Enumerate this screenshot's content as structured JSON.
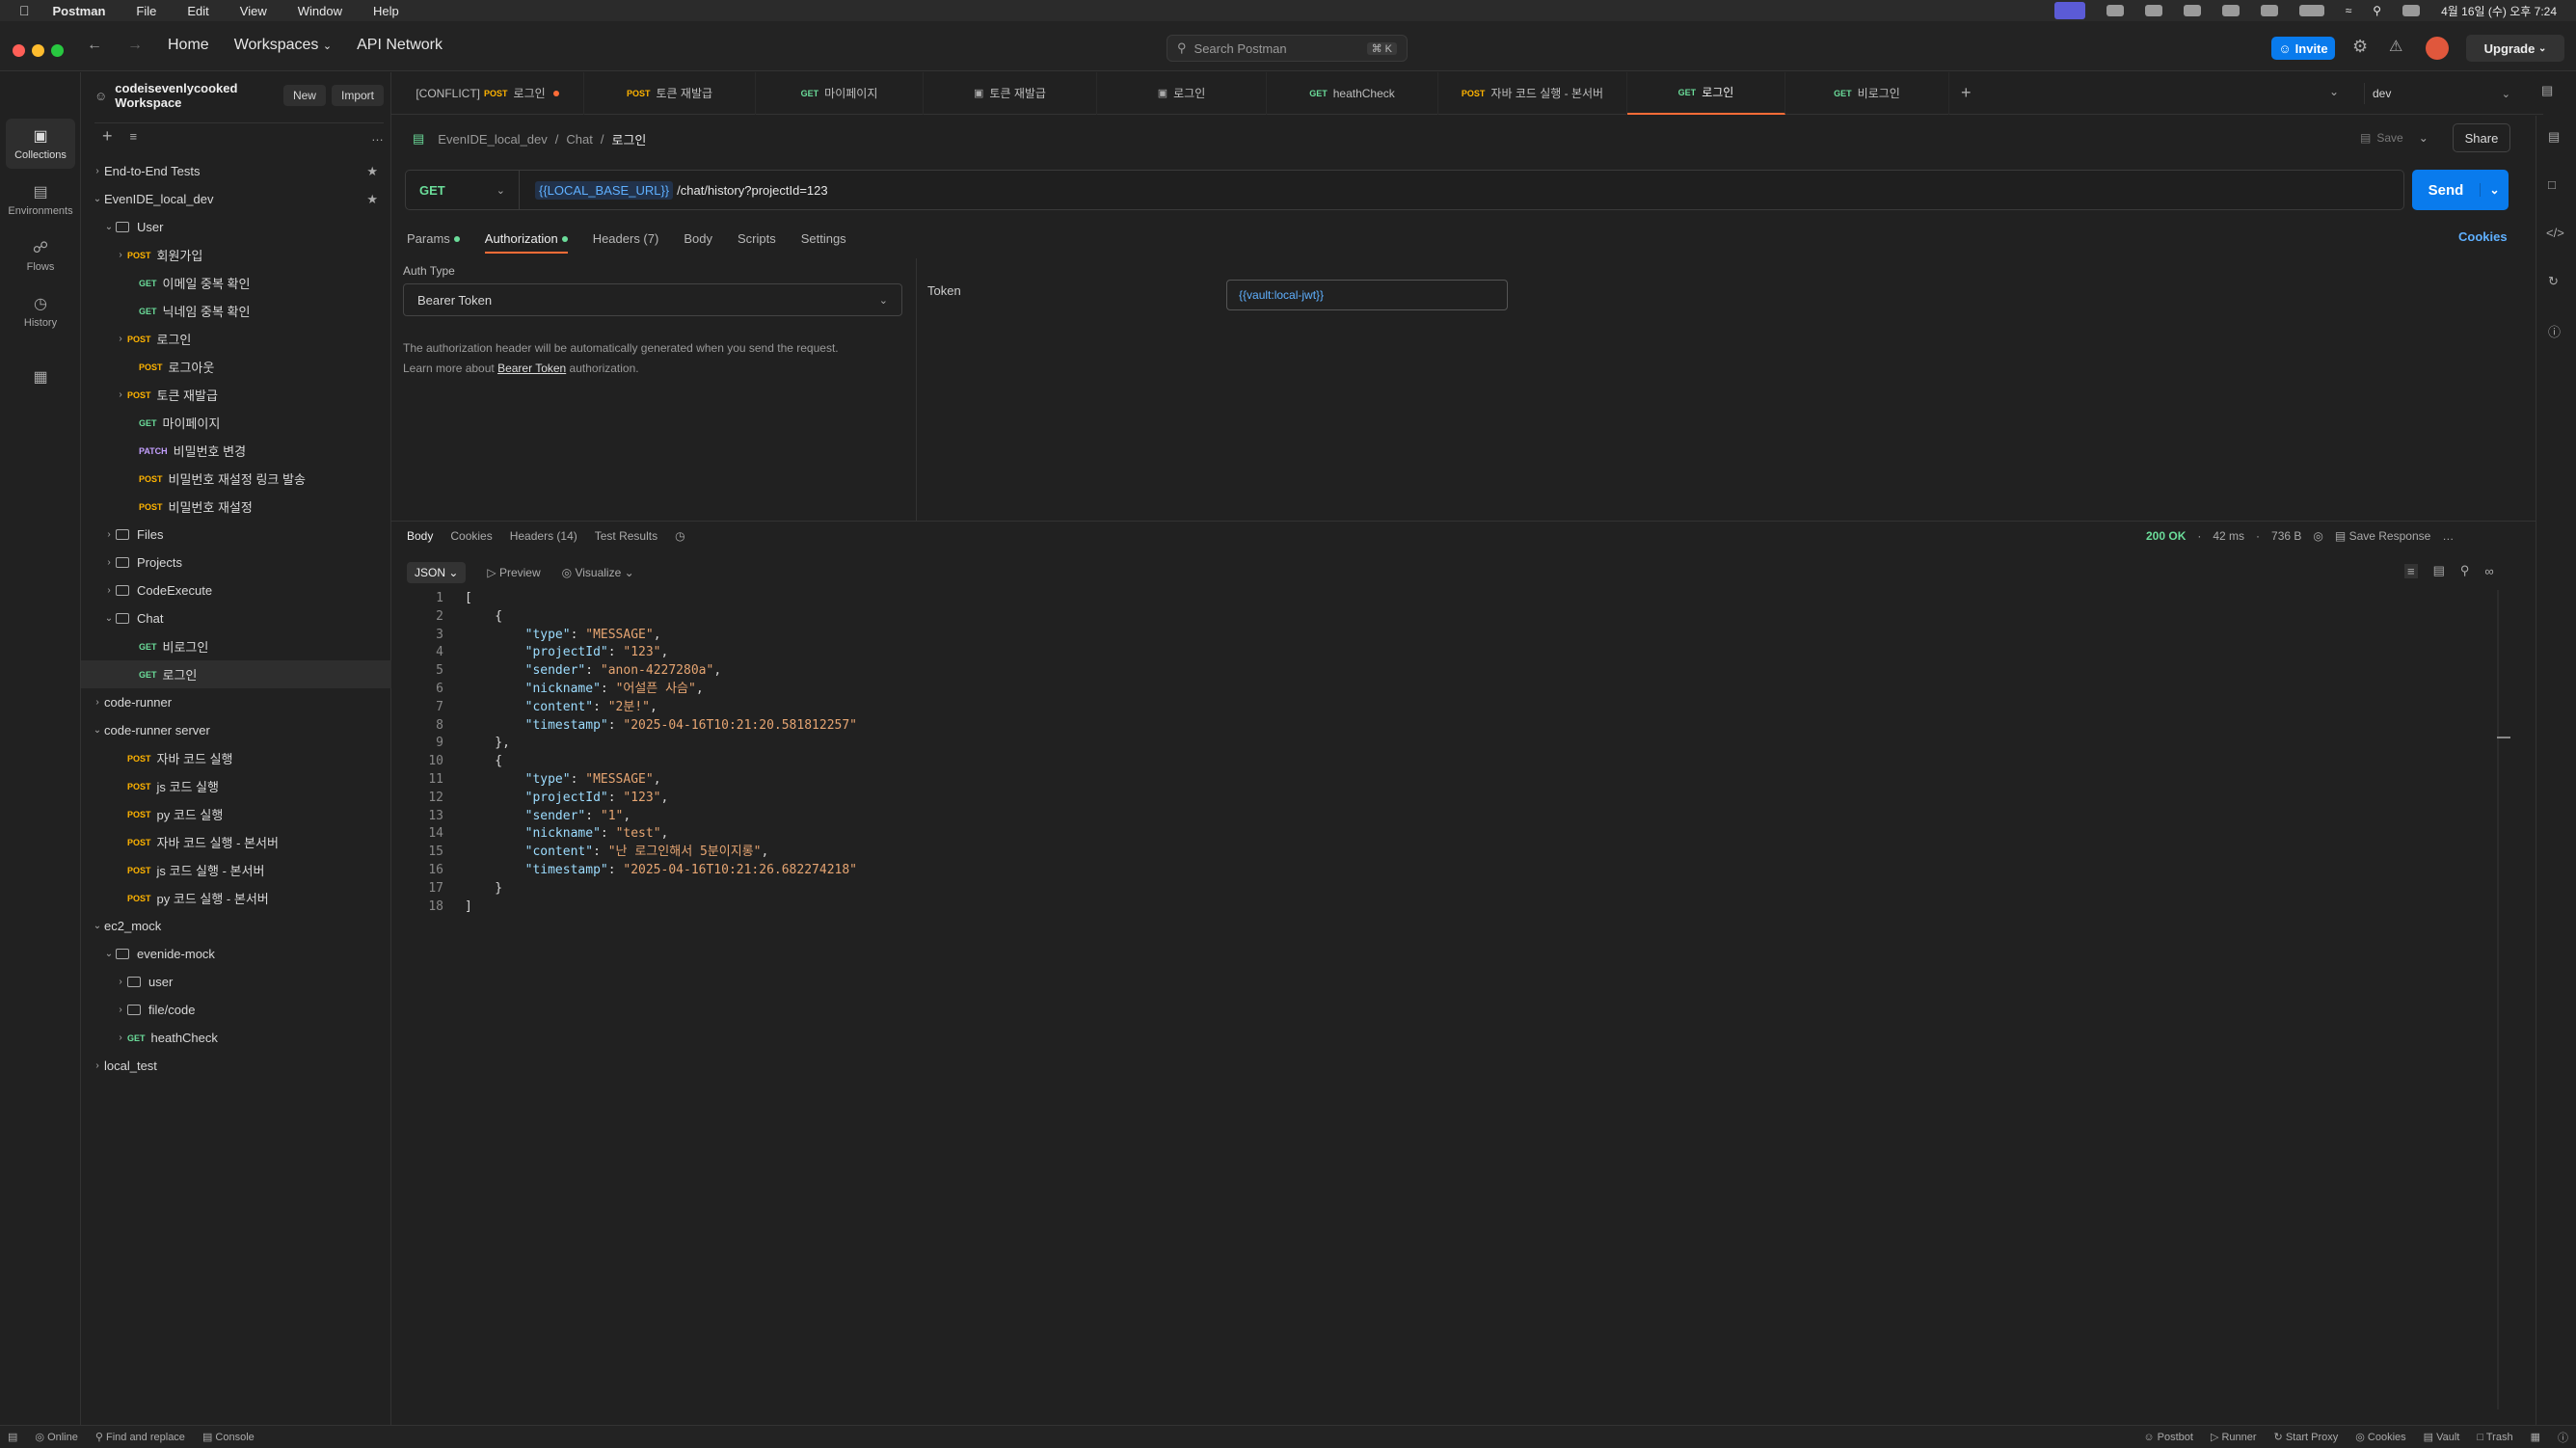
{
  "menubar": {
    "app": "Postman",
    "items": [
      "File",
      "Edit",
      "View",
      "Window",
      "Help"
    ],
    "datetime": "4월 16일 (수) 오후 7:24"
  },
  "nav": {
    "home": "Home",
    "workspaces": "Workspaces",
    "api_network": "API Network",
    "search_placeholder": "Search Postman",
    "search_kbd": "⌘ K",
    "invite": "Invite",
    "upgrade": "Upgrade"
  },
  "workspace": {
    "name": "codeisevenlycooked Workspace",
    "new": "New",
    "import": "Import"
  },
  "rail": [
    {
      "label": "Collections"
    },
    {
      "label": "Environments"
    },
    {
      "label": "Flows"
    },
    {
      "label": "History"
    }
  ],
  "tree": [
    {
      "depth": 0,
      "caret": "›",
      "label": "End-to-End Tests",
      "star": true
    },
    {
      "depth": 0,
      "caret": "⌄",
      "label": "EvenIDE_local_dev",
      "star": true
    },
    {
      "depth": 1,
      "caret": "⌄",
      "folder": true,
      "label": "User"
    },
    {
      "depth": 2,
      "caret": "›",
      "method": "POST",
      "label": "회원가입"
    },
    {
      "depth": 3,
      "method": "GET",
      "label": "이메일 중복 확인"
    },
    {
      "depth": 3,
      "method": "GET",
      "label": "닉네임 중복 확인"
    },
    {
      "depth": 2,
      "caret": "›",
      "method": "POST",
      "label": "로그인"
    },
    {
      "depth": 3,
      "method": "POST",
      "label": "로그아웃"
    },
    {
      "depth": 2,
      "caret": "›",
      "method": "POST",
      "label": "토큰 재발급"
    },
    {
      "depth": 3,
      "method": "GET",
      "label": "마이페이지"
    },
    {
      "depth": 3,
      "method": "PATCH",
      "label": "비밀번호 변경"
    },
    {
      "depth": 3,
      "method": "POST",
      "label": "비밀번호 재설정 링크 발송"
    },
    {
      "depth": 3,
      "method": "POST",
      "label": "비밀번호 재설정"
    },
    {
      "depth": 1,
      "caret": "›",
      "folder": true,
      "label": "Files"
    },
    {
      "depth": 1,
      "caret": "›",
      "folder": true,
      "label": "Projects"
    },
    {
      "depth": 1,
      "caret": "›",
      "folder": true,
      "label": "CodeExecute"
    },
    {
      "depth": 1,
      "caret": "⌄",
      "folder": true,
      "label": "Chat"
    },
    {
      "depth": 3,
      "method": "GET",
      "label": "비로그인"
    },
    {
      "depth": 3,
      "method": "GET",
      "label": "로그인",
      "selected": true
    },
    {
      "depth": 0,
      "caret": "›",
      "label": "code-runner"
    },
    {
      "depth": 0,
      "caret": "⌄",
      "label": "code-runner server"
    },
    {
      "depth": 2,
      "method": "POST",
      "label": "자바 코드 실행"
    },
    {
      "depth": 2,
      "method": "POST",
      "label": "js 코드 실행"
    },
    {
      "depth": 2,
      "method": "POST",
      "label": "py 코드 실행"
    },
    {
      "depth": 2,
      "method": "POST",
      "label": "자바 코드 실행 - 본서버"
    },
    {
      "depth": 2,
      "method": "POST",
      "label": "js 코드 실행 - 본서버"
    },
    {
      "depth": 2,
      "method": "POST",
      "label": "py 코드 실행 - 본서버"
    },
    {
      "depth": 0,
      "caret": "⌄",
      "label": "ec2_mock"
    },
    {
      "depth": 1,
      "caret": "⌄",
      "folder": true,
      "label": "evenide-mock"
    },
    {
      "depth": 2,
      "caret": "›",
      "folder": true,
      "label": "user"
    },
    {
      "depth": 2,
      "caret": "›",
      "folder": true,
      "label": "file/code"
    },
    {
      "depth": 2,
      "caret": "›",
      "method": "GET",
      "label": "heathCheck"
    },
    {
      "depth": 0,
      "caret": "›",
      "label": "local_test"
    }
  ],
  "tabs": [
    {
      "prefix": "[CONFLICT]",
      "method": "POST",
      "label": "로그인",
      "dot": true
    },
    {
      "method": "POST",
      "label": "토큰 재발급"
    },
    {
      "method": "GET",
      "label": "마이페이지"
    },
    {
      "icon": true,
      "label": "토큰 재발급"
    },
    {
      "icon": true,
      "label": "로그인"
    },
    {
      "method": "GET",
      "label": "heathCheck"
    },
    {
      "method": "POST",
      "label": "자바 코드 실행 - 본서버"
    },
    {
      "method": "GET",
      "label": "로그인",
      "active": true
    },
    {
      "method": "GET",
      "label": "비로그인"
    }
  ],
  "env": "dev",
  "breadcrumb": {
    "collection": "EvenIDE_local_dev",
    "folder": "Chat",
    "request": "로그인"
  },
  "actions": {
    "save": "Save",
    "share": "Share"
  },
  "request": {
    "method": "GET",
    "url_var": "{{LOCAL_BASE_URL}}",
    "url_path": "/chat/history?projectId=123",
    "send": "Send"
  },
  "req_tabs": {
    "params": "Params",
    "authorization": "Authorization",
    "headers": "Headers (7)",
    "body": "Body",
    "scripts": "Scripts",
    "settings": "Settings",
    "cookies": "Cookies"
  },
  "auth": {
    "type_label": "Auth Type",
    "type_value": "Bearer Token",
    "note1": "The authorization header will be automatically generated when you send the request.",
    "note2_pre": "Learn more about ",
    "note2_link": "Bearer Token",
    "note2_post": " authorization.",
    "token_label": "Token",
    "token_value": "{{vault:local-jwt}}"
  },
  "response": {
    "tabs": [
      "Body",
      "Cookies",
      "Headers (14)",
      "Test Results"
    ],
    "status": "200 OK",
    "time": "42 ms",
    "size": "736 B",
    "save": "Save Response",
    "format": "JSON",
    "preview": "Preview",
    "visualize": "Visualize"
  },
  "json_lines": [
    {
      "n": "1",
      "t": "["
    },
    {
      "n": "2",
      "t": "    {"
    },
    {
      "n": "3",
      "k": "\"type\"",
      "v": "\"MESSAGE\"",
      "c": ","
    },
    {
      "n": "4",
      "k": "\"projectId\"",
      "v": "\"123\"",
      "c": ","
    },
    {
      "n": "5",
      "k": "\"sender\"",
      "v": "\"anon-4227280a\"",
      "c": ","
    },
    {
      "n": "6",
      "k": "\"nickname\"",
      "v": "\"어설픈 사슴\"",
      "c": ","
    },
    {
      "n": "7",
      "k": "\"content\"",
      "v": "\"2분!\"",
      "c": ","
    },
    {
      "n": "8",
      "k": "\"timestamp\"",
      "v": "\"2025-04-16T10:21:20.581812257\"",
      "c": ""
    },
    {
      "n": "9",
      "t": "    },"
    },
    {
      "n": "10",
      "t": "    {"
    },
    {
      "n": "11",
      "k": "\"type\"",
      "v": "\"MESSAGE\"",
      "c": ","
    },
    {
      "n": "12",
      "k": "\"projectId\"",
      "v": "\"123\"",
      "c": ","
    },
    {
      "n": "13",
      "k": "\"sender\"",
      "v": "\"1\"",
      "c": ","
    },
    {
      "n": "14",
      "k": "\"nickname\"",
      "v": "\"test\"",
      "c": ","
    },
    {
      "n": "15",
      "k": "\"content\"",
      "v": "\"난 로그인해서 5분이지롱\"",
      "c": ","
    },
    {
      "n": "16",
      "k": "\"timestamp\"",
      "v": "\"2025-04-16T10:21:26.682274218\"",
      "c": ""
    },
    {
      "n": "17",
      "t": "    }"
    },
    {
      "n": "18",
      "t": "]"
    }
  ],
  "status_left": [
    "Online",
    "Find and replace",
    "Console"
  ],
  "status_right": [
    "Postbot",
    "Runner",
    "Start Proxy",
    "Cookies",
    "Vault",
    "Trash"
  ],
  "colors": {
    "accent": "#ff6c37",
    "send": "#097bed",
    "get": "#6bdd9a",
    "post": "#ffb400",
    "ok": "#6bdd9a"
  }
}
